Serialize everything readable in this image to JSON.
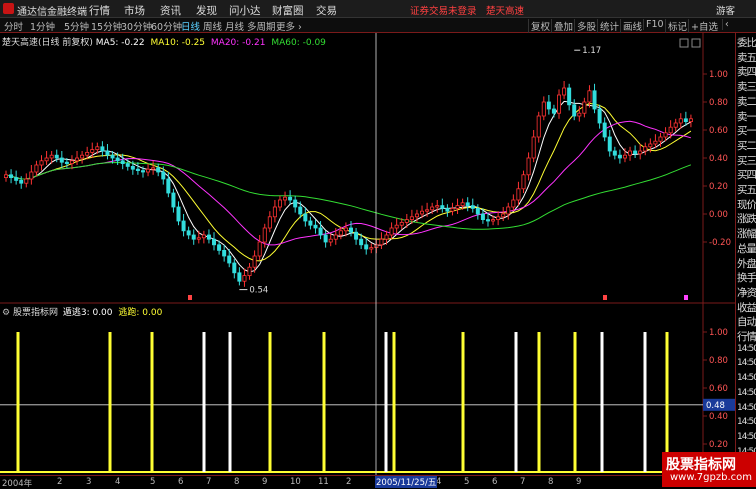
{
  "app": {
    "title": "通达信金融终端"
  },
  "menu": [
    "行情",
    "市场",
    "资讯",
    "发现",
    "问小达",
    "财富圈",
    "交易"
  ],
  "status": {
    "login_warning": "证券交易未登录",
    "stock_name": "楚天高速",
    "guest": "游客"
  },
  "periods": [
    {
      "label": "分时",
      "active": false
    },
    {
      "label": "1分钟",
      "active": false
    },
    {
      "label": "5分钟",
      "active": false
    },
    {
      "label": "15分钟",
      "active": false
    },
    {
      "label": "30分钟",
      "active": false
    },
    {
      "label": "60分钟",
      "active": false
    },
    {
      "label": "日线",
      "active": true
    },
    {
      "label": "周线",
      "active": false
    },
    {
      "label": "月线",
      "active": false
    },
    {
      "label": "多周期",
      "active": false
    },
    {
      "label": "更多 ›",
      "active": false
    }
  ],
  "right_buttons": [
    "复权",
    "叠加",
    "多股",
    "统计",
    "画线",
    "F10",
    "标记",
    "+自选",
    "‹"
  ],
  "legend_main": {
    "name": "楚天高速(日线 前复权)",
    "ma": [
      {
        "label": "MA5: -0.22",
        "color": "#ffffff"
      },
      {
        "label": "MA10: -0.25",
        "color": "#ffff33"
      },
      {
        "label": "MA20: -0.21",
        "color": "#ff33ff"
      },
      {
        "label": "MA60: -0.09",
        "color": "#33dd33"
      }
    ]
  },
  "legend_sub": {
    "name": "股票指标网",
    "v1": "遁逃3: 0.00",
    "v2": "逃跑: 0.00",
    "v2_color": "#ffff33"
  },
  "chart_data": {
    "type": "candlestick",
    "y_ticks_main": [
      "1.00",
      "0.80",
      "0.60",
      "0.40",
      "0.20",
      "0.00",
      "-0.20"
    ],
    "y_ticks_sub": [
      "1.00",
      "0.80",
      "0.60",
      "0.40",
      "0.20"
    ],
    "annotations": {
      "high": "1.17",
      "low": "0.54",
      "cursor_value": "0.48"
    },
    "x_labels": [
      "2004年",
      "2",
      "3",
      "4",
      "5",
      "6",
      "7",
      "8",
      "9",
      "10",
      "11",
      "2",
      "3",
      "4",
      "5",
      "6",
      "7",
      "8",
      "9"
    ],
    "cursor_date": "2005/11/25/五",
    "close": [
      0.28,
      0.26,
      0.24,
      0.22,
      0.25,
      0.3,
      0.35,
      0.38,
      0.4,
      0.42,
      0.4,
      0.37,
      0.36,
      0.38,
      0.4,
      0.42,
      0.44,
      0.46,
      0.48,
      0.45,
      0.42,
      0.4,
      0.38,
      0.36,
      0.34,
      0.32,
      0.31,
      0.3,
      0.32,
      0.33,
      0.3,
      0.25,
      0.15,
      0.05,
      -0.05,
      -0.12,
      -0.15,
      -0.18,
      -0.17,
      -0.15,
      -0.18,
      -0.22,
      -0.26,
      -0.3,
      -0.35,
      -0.42,
      -0.48,
      -0.44,
      -0.38,
      -0.3,
      -0.2,
      -0.1,
      -0.02,
      0.05,
      0.1,
      0.12,
      0.1,
      0.05,
      0.0,
      -0.05,
      -0.08,
      -0.1,
      -0.15,
      -0.2,
      -0.18,
      -0.15,
      -0.12,
      -0.1,
      -0.13,
      -0.18,
      -0.22,
      -0.25,
      -0.24,
      -0.22,
      -0.18,
      -0.15,
      -0.1,
      -0.08,
      -0.06,
      -0.04,
      -0.02,
      0.0,
      0.02,
      0.03,
      0.05,
      0.06,
      0.04,
      0.02,
      0.04,
      0.06,
      0.08,
      0.06,
      0.04,
      0.0,
      -0.04,
      -0.05,
      -0.04,
      -0.02,
      0.0,
      0.05,
      0.1,
      0.18,
      0.28,
      0.4,
      0.55,
      0.7,
      0.8,
      0.75,
      0.72,
      0.85,
      0.9,
      0.78,
      0.7,
      0.72,
      0.8,
      0.88,
      0.75,
      0.65,
      0.55,
      0.45,
      0.42,
      0.4,
      0.42,
      0.45,
      0.43,
      0.45,
      0.48,
      0.5,
      0.52,
      0.55,
      0.58,
      0.62,
      0.65,
      0.68,
      0.66,
      0.68
    ],
    "signal_bars": {
      "yellow": [
        18,
        110,
        152,
        270,
        324,
        394,
        463,
        539,
        575,
        667
      ],
      "white": [
        204,
        230,
        386,
        516,
        602,
        645
      ]
    },
    "ylim_main": [
      -0.54,
      1.17
    ],
    "ylim_sub": [
      0,
      1.0
    ]
  },
  "sidebar": [
    "委比",
    "卖五",
    "卖四",
    "卖三",
    "卖二",
    "卖一",
    "买一",
    "买二",
    "买三",
    "买四",
    "买五",
    "现价",
    "涨跌",
    "涨幅",
    "总量",
    "外盘",
    "换手",
    "净资",
    "收益",
    "自动",
    "行情",
    "14:50",
    "14:50",
    "14:50",
    "14:50",
    "14:50",
    "14:50",
    "14:50",
    "14:50",
    "14:5"
  ],
  "watermark": {
    "line1": "股票指标网",
    "line2": "www.7gpzb.com"
  }
}
